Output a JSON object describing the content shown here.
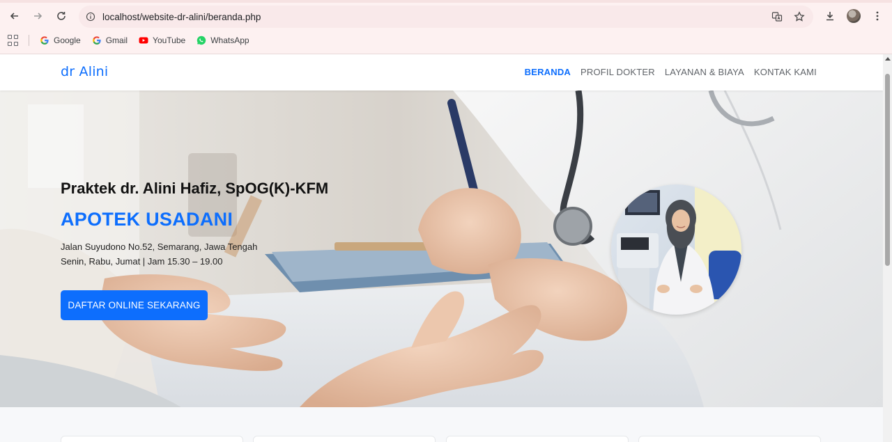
{
  "browser": {
    "url": "localhost/website-dr-alini/beranda.php",
    "bookmarks": [
      {
        "label": "Google",
        "icon": "google-icon"
      },
      {
        "label": "Gmail",
        "icon": "google-icon"
      },
      {
        "label": "YouTube",
        "icon": "youtube-icon"
      },
      {
        "label": "WhatsApp",
        "icon": "whatsapp-icon"
      }
    ]
  },
  "site": {
    "brand": "dr Alini",
    "nav": [
      "BERANDA",
      "PROFIL DOKTER",
      "LAYANAN & BIAYA",
      "KONTAK KAMI"
    ],
    "active_nav": "BERANDA",
    "accent_color": "#0d6efd"
  },
  "hero": {
    "subtitle": "Praktek dr. Alini Hafiz, SpOG(K)-KFM",
    "title": "APOTEK USADANI",
    "address": "Jalan Suyudono No.52, Semarang, Jawa Tengah",
    "hours": "Senin, Rabu, Jumat | Jam 15.30 – 19.00",
    "cta_label": "DAFTAR ONLINE SEKARANG"
  }
}
